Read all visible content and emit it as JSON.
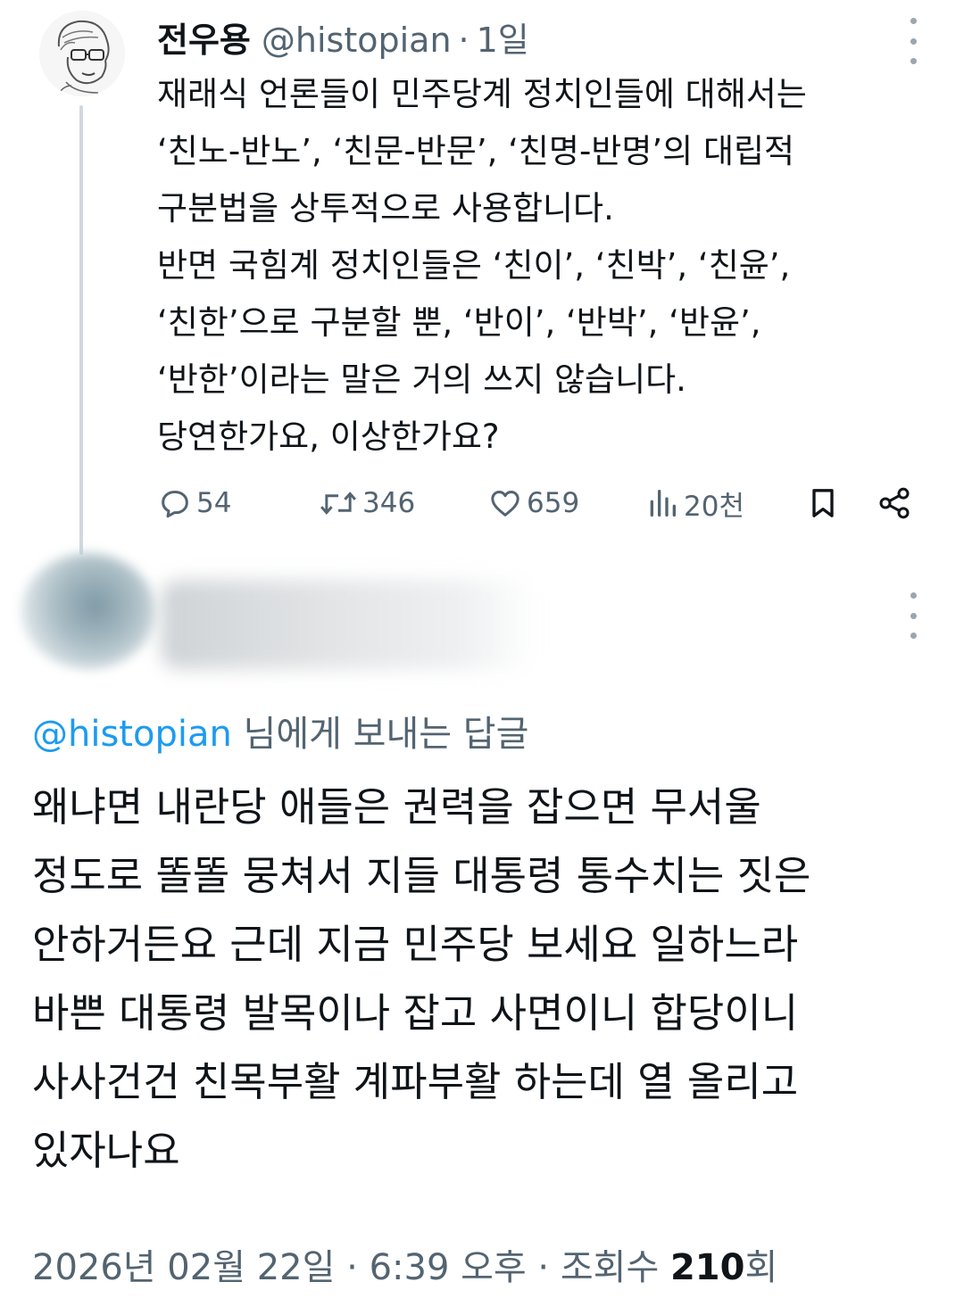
{
  "tweet": {
    "author_name": "전우용",
    "author_handle": "@histopian",
    "separator": "·",
    "time_ago": "1일",
    "lines": [
      "재래식 언론들이 민주당계 정치인들에 대해서는",
      "‘친노-반노’, ‘친문-반문’, ‘친명-반명’의 대립적",
      "구분법을 상투적으로 사용합니다.",
      "반면 국힘계 정치인들은 ‘친이’, ‘친박’, ‘친윤’,",
      "‘친한’으로 구분할 뿐, ‘반이’, ‘반박’, ‘반윤’,",
      "‘반한’이라는 말은 거의 쓰지 않습니다.",
      "당연한가요, 이상한가요?"
    ],
    "stats": {
      "replies": "54",
      "reposts": "346",
      "likes": "659",
      "views": "20천"
    },
    "icons": [
      "reply-icon",
      "repost-icon",
      "like-icon",
      "views-icon",
      "bookmark-icon",
      "share-icon",
      "more-icon"
    ]
  },
  "reply": {
    "replying_to_handle": "@histopian",
    "replying_to_suffix": " 님에게 보내는 답글",
    "lines": [
      "왜냐면 내란당 애들은 권력을 잡으면 무서울",
      "정도로 똘똘 뭉쳐서 지들 대통령 통수치는 짓은",
      "안하거든요 근데 지금 민주당 보세요 일하느라",
      "바쁜 대통령 발목이나 잡고 사면이니 합당이니",
      "사사건건 친목부활 계파부활 하는데 열 올리고",
      "있자나요"
    ],
    "timestamp": "2026년 02월 22일 · 6:39 오후 · 조회수 ",
    "views_count": "210",
    "views_suffix": "회"
  },
  "colors": {
    "text": "#0f1419",
    "secondary": "#536471",
    "accent": "#1d9bf0",
    "thread_line": "#cfd9de"
  }
}
